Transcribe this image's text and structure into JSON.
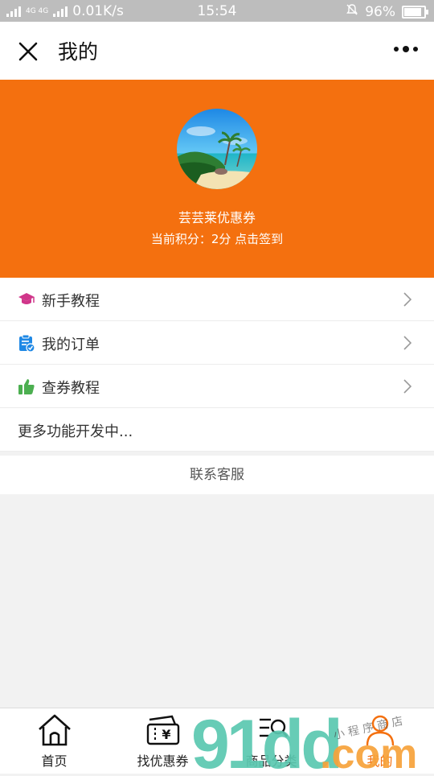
{
  "status_bar": {
    "network_label": "4G 4G",
    "speed": "0.01K/s",
    "time": "15:54",
    "battery": "96%",
    "battery_level": 0.96
  },
  "title_bar": {
    "title": "我的"
  },
  "profile": {
    "username": "芸芸莱优惠券",
    "points_text": "当前积分：2分 点击签到"
  },
  "menu": {
    "items": [
      {
        "label": "新手教程",
        "icon": "graduation-cap-icon",
        "color": "#d0368a"
      },
      {
        "label": "我的订单",
        "icon": "clipboard-check-icon",
        "color": "#1e88e5"
      },
      {
        "label": "查券教程",
        "icon": "thumbs-up-icon",
        "color": "#4caf50"
      }
    ],
    "more": "更多功能开发中..."
  },
  "contact": {
    "label": "联系客服"
  },
  "tab_bar": {
    "tabs": [
      {
        "label": "首页",
        "icon": "home-icon"
      },
      {
        "label": "找优惠券",
        "icon": "coupon-icon"
      },
      {
        "label": "商品分类",
        "icon": "category-search-icon"
      },
      {
        "label": "我的",
        "icon": "user-icon"
      }
    ],
    "active_index": 3
  },
  "watermark": {
    "text": "91dd.com",
    "subtext": "小程序商店"
  },
  "colors": {
    "accent": "#f4700f",
    "status_bar_bg": "#bdbdbd",
    "page_bg": "#f2f2f2"
  }
}
